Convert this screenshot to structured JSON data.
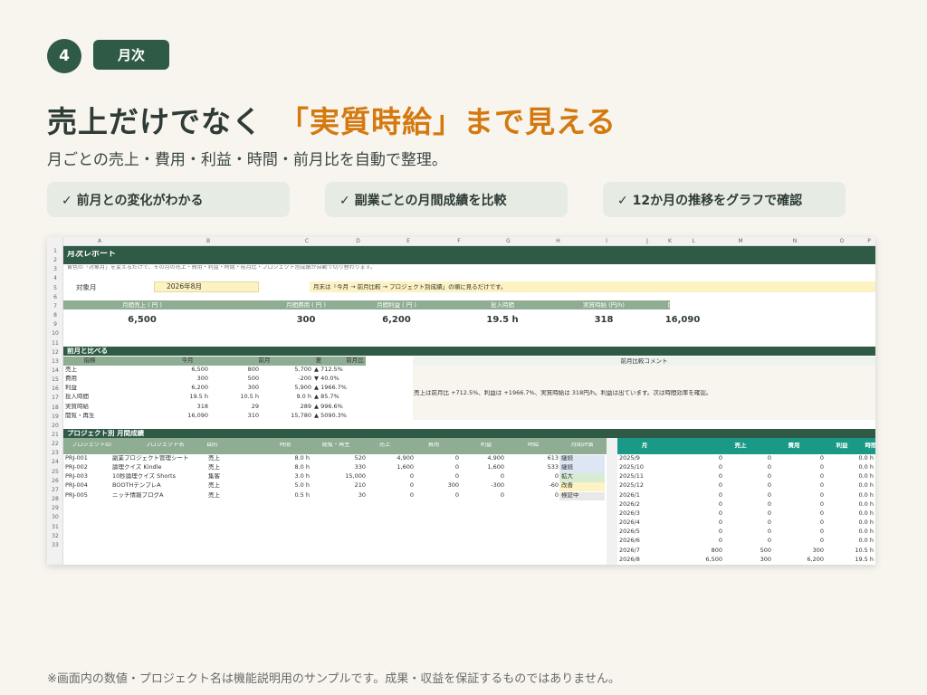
{
  "step": {
    "number": "4",
    "tag": "月次"
  },
  "headline": {
    "main": "売上だけでなく",
    "accent": "「実質時給」まで見える"
  },
  "subtitle": "月ごとの売上・費用・利益・時間・前月比を自動で整理。",
  "features": [
    "✓ 前月との変化がわかる",
    "✓ 副業ごとの月間成績を比較",
    "✓ 12か月の推移をグラフで確認"
  ],
  "footnote": "※画面内の数値・プロジェクト名は機能説明用のサンプルです。成果・収益を保証するものではありません。",
  "colors": {
    "dark_green": "#2f5a45",
    "accent_orange": "#d4790f",
    "teal": "#1a9a86",
    "kpi_header": "#8fad93",
    "light_yellow": "#fcf2c2"
  },
  "sheet": {
    "columns": [
      "A",
      "B",
      "C",
      "D",
      "E",
      "F",
      "G",
      "H",
      "I",
      "J",
      "K",
      "L",
      "M",
      "N",
      "O",
      "P"
    ],
    "title": "月次レポート",
    "description": "黄色の「対象月」を変えるだけで、その月の売上・費用・利益・時間・前月比・プロジェクト別成績が自動で切り替わります。",
    "target_label": "対象月",
    "target_value": "2026年8月",
    "target_hint": "月末は「今月 → 前月比較 → プロジェクト別成績」の順に見るだけです。",
    "kpis": [
      {
        "label": "月間売上 ( 円 )",
        "value": "6,500"
      },
      {
        "label": "月間費用 ( 円 )",
        "value": "300"
      },
      {
        "label": "月間利益 ( 円 )",
        "value": "6,200"
      },
      {
        "label": "投入時間",
        "value": "19.5 h"
      },
      {
        "label": "実質時給 (円/h)",
        "value": "318"
      },
      {
        "label": "閲覧・再生",
        "value": "16,090"
      }
    ],
    "compare": {
      "title": "前月と比べる",
      "headers": [
        "指標",
        "今月",
        "前月",
        "差",
        "前月比"
      ],
      "rows": [
        [
          "売上",
          "6,500",
          "800",
          "5,700",
          "▲ 712.5%"
        ],
        [
          "費用",
          "300",
          "500",
          "-200",
          "▼ 40.0%"
        ],
        [
          "利益",
          "6,200",
          "300",
          "5,900",
          "▲ 1966.7%"
        ],
        [
          "投入時間",
          "19.5 h",
          "10.5 h",
          "9.0 h",
          "▲ 85.7%"
        ],
        [
          "実質時給",
          "318",
          "29",
          "289",
          "▲ 996.6%"
        ],
        [
          "閲覧・再生",
          "16,090",
          "310",
          "15,780",
          "▲ 5090.3%"
        ]
      ],
      "comment_header": "前月比較コメント",
      "comment": "売上は前月比 +712.5%、利益は +1966.7%、実質時給は 318円/h。利益は出ています。次は時間効率を確認。"
    },
    "projects": {
      "title": "プロジェクト別 月間成績",
      "headers": [
        "プロジェクトID",
        "プロジェクト名",
        "目的",
        "時間",
        "閲覧・再生",
        "売上",
        "費用",
        "利益",
        "時給",
        "月間評価"
      ],
      "rows": [
        [
          "PRJ-001",
          "副業プロジェクト管理シート",
          "売上",
          "8.0 h",
          "520",
          "4,900",
          "0",
          "4,900",
          "613",
          "継続"
        ],
        [
          "PRJ-002",
          "論理クイズ Kindle",
          "売上",
          "8.0 h",
          "330",
          "1,600",
          "0",
          "1,600",
          "533",
          "継続"
        ],
        [
          "PRJ-003",
          "10秒論理クイズ Shorts",
          "集客",
          "3.0 h",
          "15,000",
          "0",
          "0",
          "0",
          "0",
          "拡大"
        ],
        [
          "PRJ-004",
          "BOOTHテンプレA",
          "売上",
          "5.0 h",
          "210",
          "0",
          "300",
          "-300",
          "-60",
          "改善"
        ],
        [
          "PRJ-005",
          "ニッチ情報ブログA",
          "売上",
          "0.5 h",
          "30",
          "0",
          "0",
          "0",
          "0",
          "検証中"
        ]
      ]
    },
    "trend": {
      "headers": [
        "月",
        "売上",
        "費用",
        "利益",
        "時間"
      ],
      "rows": [
        [
          "2025/9",
          "0",
          "0",
          "0",
          "0.0 h"
        ],
        [
          "2025/10",
          "0",
          "0",
          "0",
          "0.0 h"
        ],
        [
          "2025/11",
          "0",
          "0",
          "0",
          "0.0 h"
        ],
        [
          "2025/12",
          "0",
          "0",
          "0",
          "0.0 h"
        ],
        [
          "2026/1",
          "0",
          "0",
          "0",
          "0.0 h"
        ],
        [
          "2026/2",
          "0",
          "0",
          "0",
          "0.0 h"
        ],
        [
          "2026/3",
          "0",
          "0",
          "0",
          "0.0 h"
        ],
        [
          "2026/4",
          "0",
          "0",
          "0",
          "0.0 h"
        ],
        [
          "2026/5",
          "0",
          "0",
          "0",
          "0.0 h"
        ],
        [
          "2026/6",
          "0",
          "0",
          "0",
          "0.0 h"
        ],
        [
          "2026/7",
          "800",
          "500",
          "300",
          "10.5 h"
        ],
        [
          "2026/8",
          "6,500",
          "300",
          "6,200",
          "19.5 h"
        ]
      ]
    }
  }
}
